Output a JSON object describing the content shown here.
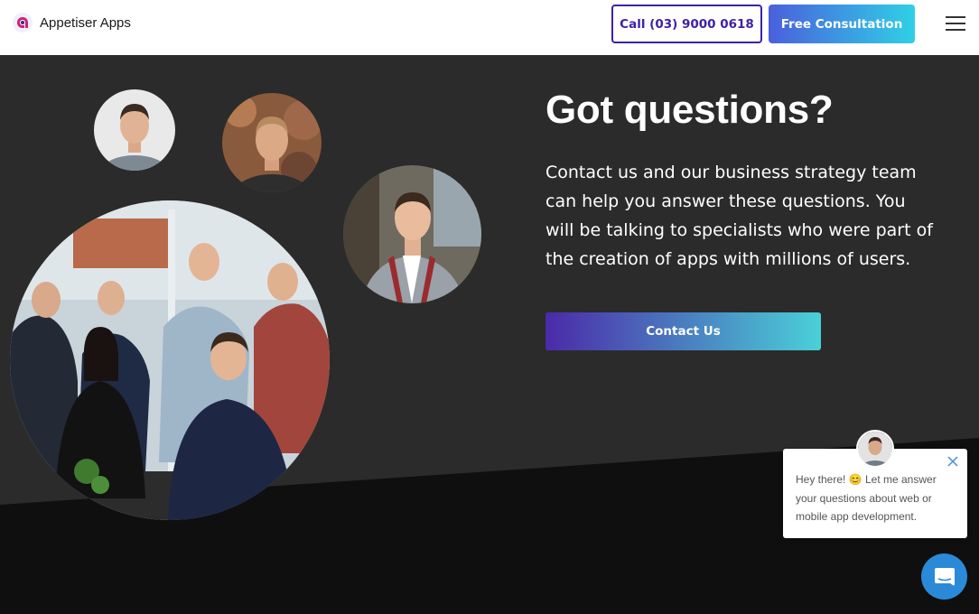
{
  "header": {
    "brand": "Appetiser Apps",
    "call_label": "Call (03) 9000 0618",
    "consult_label": "Free Consultation",
    "menu_icon": "hamburger-icon"
  },
  "hero": {
    "heading": "Got questions?",
    "body": "Contact us and our business strategy team can help you answer these questions. You will be talking to specialists who were part of the creation of apps with millions of users.",
    "contact_label": "Contact Us"
  },
  "chat": {
    "message_before_emoji": "Hey there! ",
    "emoji": "😊",
    "message_after_emoji": " Let me answer your questions about web or mobile app development.",
    "close_icon": "close-icon",
    "launcher_icon": "chat-icon"
  },
  "colors": {
    "brand_purple": "#3d22a6",
    "consult_gradient_start": "#4a60dc",
    "consult_gradient_end": "#2fd0e6",
    "hero_bg": "#2b2b2b",
    "hero_dark": "#0f0f0f",
    "chat_blue": "#2b8ad8"
  }
}
